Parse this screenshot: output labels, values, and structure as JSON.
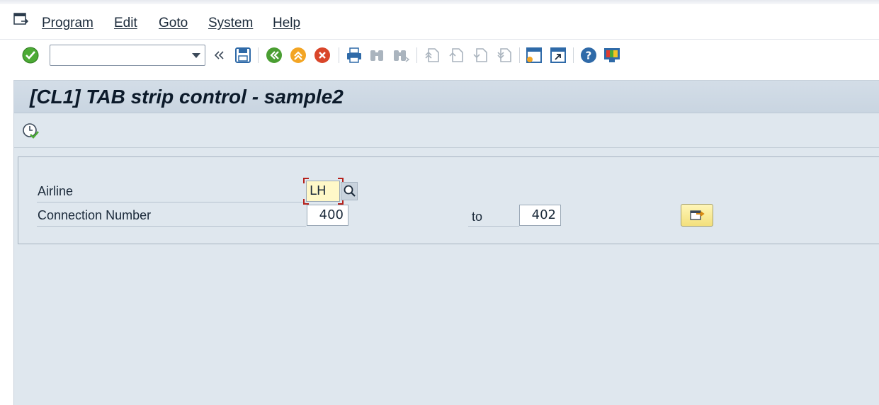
{
  "menubar": {
    "items": [
      {
        "label": "Program"
      },
      {
        "label": "Edit"
      },
      {
        "label": "Goto"
      },
      {
        "label": "System"
      },
      {
        "label": "Help"
      }
    ]
  },
  "toolbar": {
    "command_field_value": "",
    "icons": [
      "enter-icon",
      "back-double-arrow-icon",
      "save-icon",
      "back-icon",
      "exit-icon",
      "cancel-icon",
      "print-icon",
      "find-icon",
      "find-next-icon",
      "first-page-icon",
      "previous-page-icon",
      "next-page-icon",
      "last-page-icon",
      "create-session-icon",
      "shortcut-icon",
      "help-icon",
      "customize-layout-icon"
    ]
  },
  "title": "[CL1] TAB strip control - sample2",
  "app_toolbar": {
    "icons": [
      "execute-icon"
    ]
  },
  "form": {
    "airline_label": "Airline",
    "airline_value": "LH",
    "connection_label": "Connection Number",
    "connection_from": "400",
    "to_label": "to",
    "connection_to": "402"
  },
  "colors": {
    "background": "#dfe7ee",
    "title_bar": "#cdd8e3",
    "focus_field": "#fff8c8",
    "focus_corner": "#b6221c",
    "enter_green": "#3a9a2a",
    "exit_orange": "#f0a020",
    "cancel_red": "#d9462a"
  }
}
